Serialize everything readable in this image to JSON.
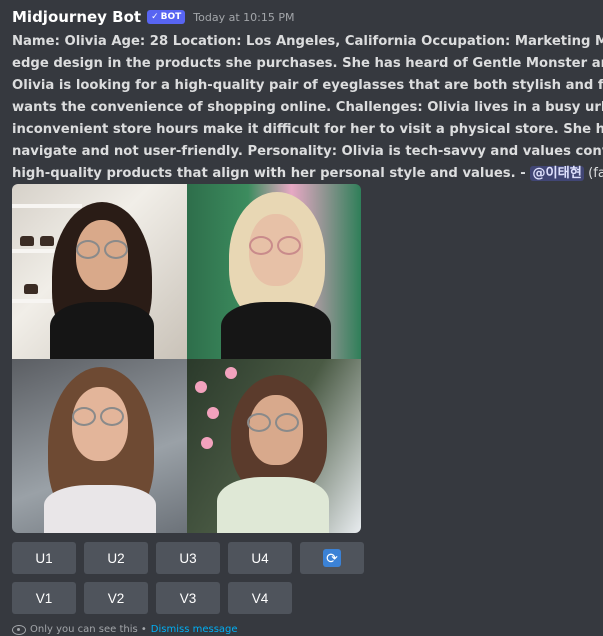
{
  "message": {
    "author": "Midjourney Bot",
    "bot_badge": "BOT",
    "bot_badge_check": "✓",
    "timestamp": "Today at 10:15 PM",
    "lines": [
      "Name: Olivia Age: 28 Location: Los Angeles, California Occupation: Marketing Mana",
      "edge design in the products she purchases. She has heard of Gentle Monster and is in",
      "Olivia is looking for a high-quality pair of eyeglasses that are both stylish and functio",
      "wants the convenience of shopping online. Challenges: Olivia lives in a busy urban ar",
      "inconvenient store hours make it difficult for her to visit a physical store. She has als",
      "navigate and not user-friendly. Personality: Olivia is tech-savvy and values convenie",
      "high-quality products that align with her personal style and values. - "
    ],
    "mention": "@이태현",
    "speed": " (fast)"
  },
  "image_grid": {
    "tiles": [
      "tile-1",
      "tile-2",
      "tile-3",
      "tile-4"
    ]
  },
  "upscale_buttons": [
    "U1",
    "U2",
    "U3",
    "U4"
  ],
  "variation_buttons": [
    "V1",
    "V2",
    "V3",
    "V4"
  ],
  "refresh_icon": "🔄",
  "footer": {
    "notice": "Only you can see this •",
    "dismiss": "Dismiss message"
  },
  "colors": {
    "background": "#36393f",
    "button": "#4f545c",
    "bot_badge": "#5865f2",
    "mention_bg": "#414675",
    "link": "#00aff4"
  }
}
